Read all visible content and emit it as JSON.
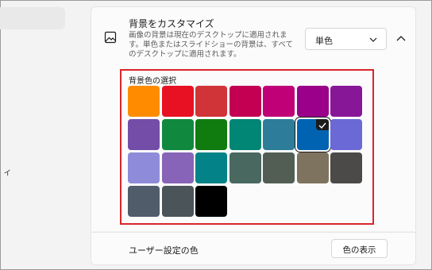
{
  "header": {
    "title": "背景をカスタマイズ",
    "description": "画像の背景は現在のデスクトップに適用されます。単色またはスライドショーの背景は、すべてのデスクトップに適用されます。",
    "dropdown_value": "単色"
  },
  "color_picker": {
    "title": "背景色の選択",
    "selected_index": 12,
    "colors": [
      "#ff8c00",
      "#e81123",
      "#d13438",
      "#c30052",
      "#bf0077",
      "#9a0089",
      "#881798",
      "#744da9",
      "#10893e",
      "#107c10",
      "#018574",
      "#2d7d9a",
      "#0063b1",
      "#6b69d6",
      "#8e8cd8",
      "#8764b8",
      "#038387",
      "#486860",
      "#525e54",
      "#7e735f",
      "#4c4a48",
      "#515c6b",
      "#4a5459",
      "#000000"
    ]
  },
  "user_color": {
    "label": "ユーザー設定の色",
    "button_label": "色の表示"
  },
  "sidebar": {
    "fragment": "ィ"
  }
}
